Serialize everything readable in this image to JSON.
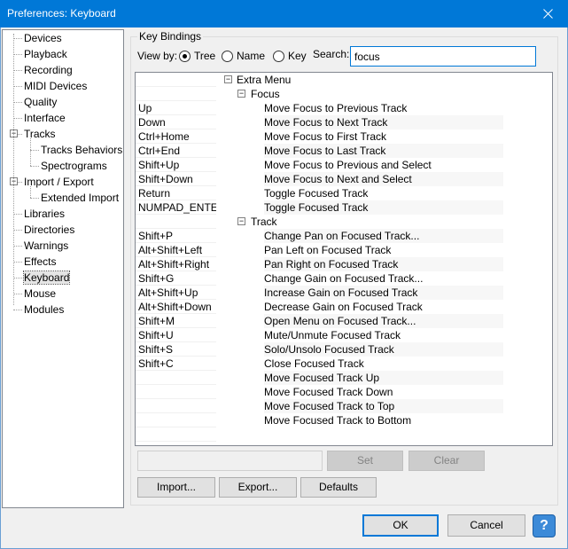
{
  "window": {
    "title": "Preferences: Keyboard"
  },
  "sidebar": {
    "items": [
      {
        "label": "Devices"
      },
      {
        "label": "Playback"
      },
      {
        "label": "Recording"
      },
      {
        "label": "MIDI Devices"
      },
      {
        "label": "Quality"
      },
      {
        "label": "Interface"
      },
      {
        "label": "Tracks",
        "expander": "⊟"
      },
      {
        "label": "Tracks Behaviors"
      },
      {
        "label": "Spectrograms"
      },
      {
        "label": "Import / Export",
        "expander": "⊟"
      },
      {
        "label": "Extended Import"
      },
      {
        "label": "Libraries"
      },
      {
        "label": "Directories"
      },
      {
        "label": "Warnings"
      },
      {
        "label": "Effects"
      },
      {
        "label": "Keyboard",
        "selected": true
      },
      {
        "label": "Mouse"
      },
      {
        "label": "Modules"
      }
    ]
  },
  "bindings": {
    "group_label": "Key Bindings",
    "view_by_label": "View by:",
    "view_options": [
      {
        "label": "Tree",
        "checked": true
      },
      {
        "label": "Name",
        "checked": false
      },
      {
        "label": "Key",
        "checked": false
      }
    ],
    "search_label": "Search:",
    "search_value": "focus",
    "tree": {
      "root": "Extra Menu",
      "groups": [
        {
          "name": "Focus",
          "commands": [
            {
              "cmd": "Move Focus to Previous Track",
              "key": "Up"
            },
            {
              "cmd": "Move Focus to Next Track",
              "key": "Down"
            },
            {
              "cmd": "Move Focus to First Track",
              "key": "Ctrl+Home"
            },
            {
              "cmd": "Move Focus to Last Track",
              "key": "Ctrl+End"
            },
            {
              "cmd": "Move Focus to Previous and Select",
              "key": "Shift+Up"
            },
            {
              "cmd": "Move Focus to Next and Select",
              "key": "Shift+Down"
            },
            {
              "cmd": "Toggle Focused Track",
              "key": "Return"
            },
            {
              "cmd": "Toggle Focused Track",
              "key": "NUMPAD_ENTER"
            }
          ]
        },
        {
          "name": "Track",
          "commands": [
            {
              "cmd": "Change Pan on Focused Track...",
              "key": "Shift+P"
            },
            {
              "cmd": "Pan Left on Focused Track",
              "key": "Alt+Shift+Left"
            },
            {
              "cmd": "Pan Right on Focused Track",
              "key": "Alt+Shift+Right"
            },
            {
              "cmd": "Change Gain on Focused Track...",
              "key": "Shift+G"
            },
            {
              "cmd": "Increase Gain on Focused Track",
              "key": "Alt+Shift+Up"
            },
            {
              "cmd": "Decrease Gain on Focused Track",
              "key": "Alt+Shift+Down"
            },
            {
              "cmd": "Open Menu on Focused Track...",
              "key": "Shift+M"
            },
            {
              "cmd": "Mute/Unmute Focused Track",
              "key": "Shift+U"
            },
            {
              "cmd": "Solo/Unsolo Focused Track",
              "key": "Shift+S"
            },
            {
              "cmd": "Close Focused Track",
              "key": "Shift+C"
            },
            {
              "cmd": "Move Focused Track Up",
              "key": ""
            },
            {
              "cmd": "Move Focused Track Down",
              "key": ""
            },
            {
              "cmd": "Move Focused Track to Top",
              "key": ""
            },
            {
              "cmd": "Move Focused Track to Bottom",
              "key": ""
            }
          ]
        }
      ]
    },
    "set_label": "Set",
    "clear_label": "Clear",
    "import_label": "Import...",
    "export_label": "Export...",
    "defaults_label": "Defaults"
  },
  "footer": {
    "ok_label": "OK",
    "cancel_label": "Cancel",
    "help_label": "?"
  },
  "colors": {
    "titlebar": "#0078d7",
    "accent": "#0078d7"
  }
}
